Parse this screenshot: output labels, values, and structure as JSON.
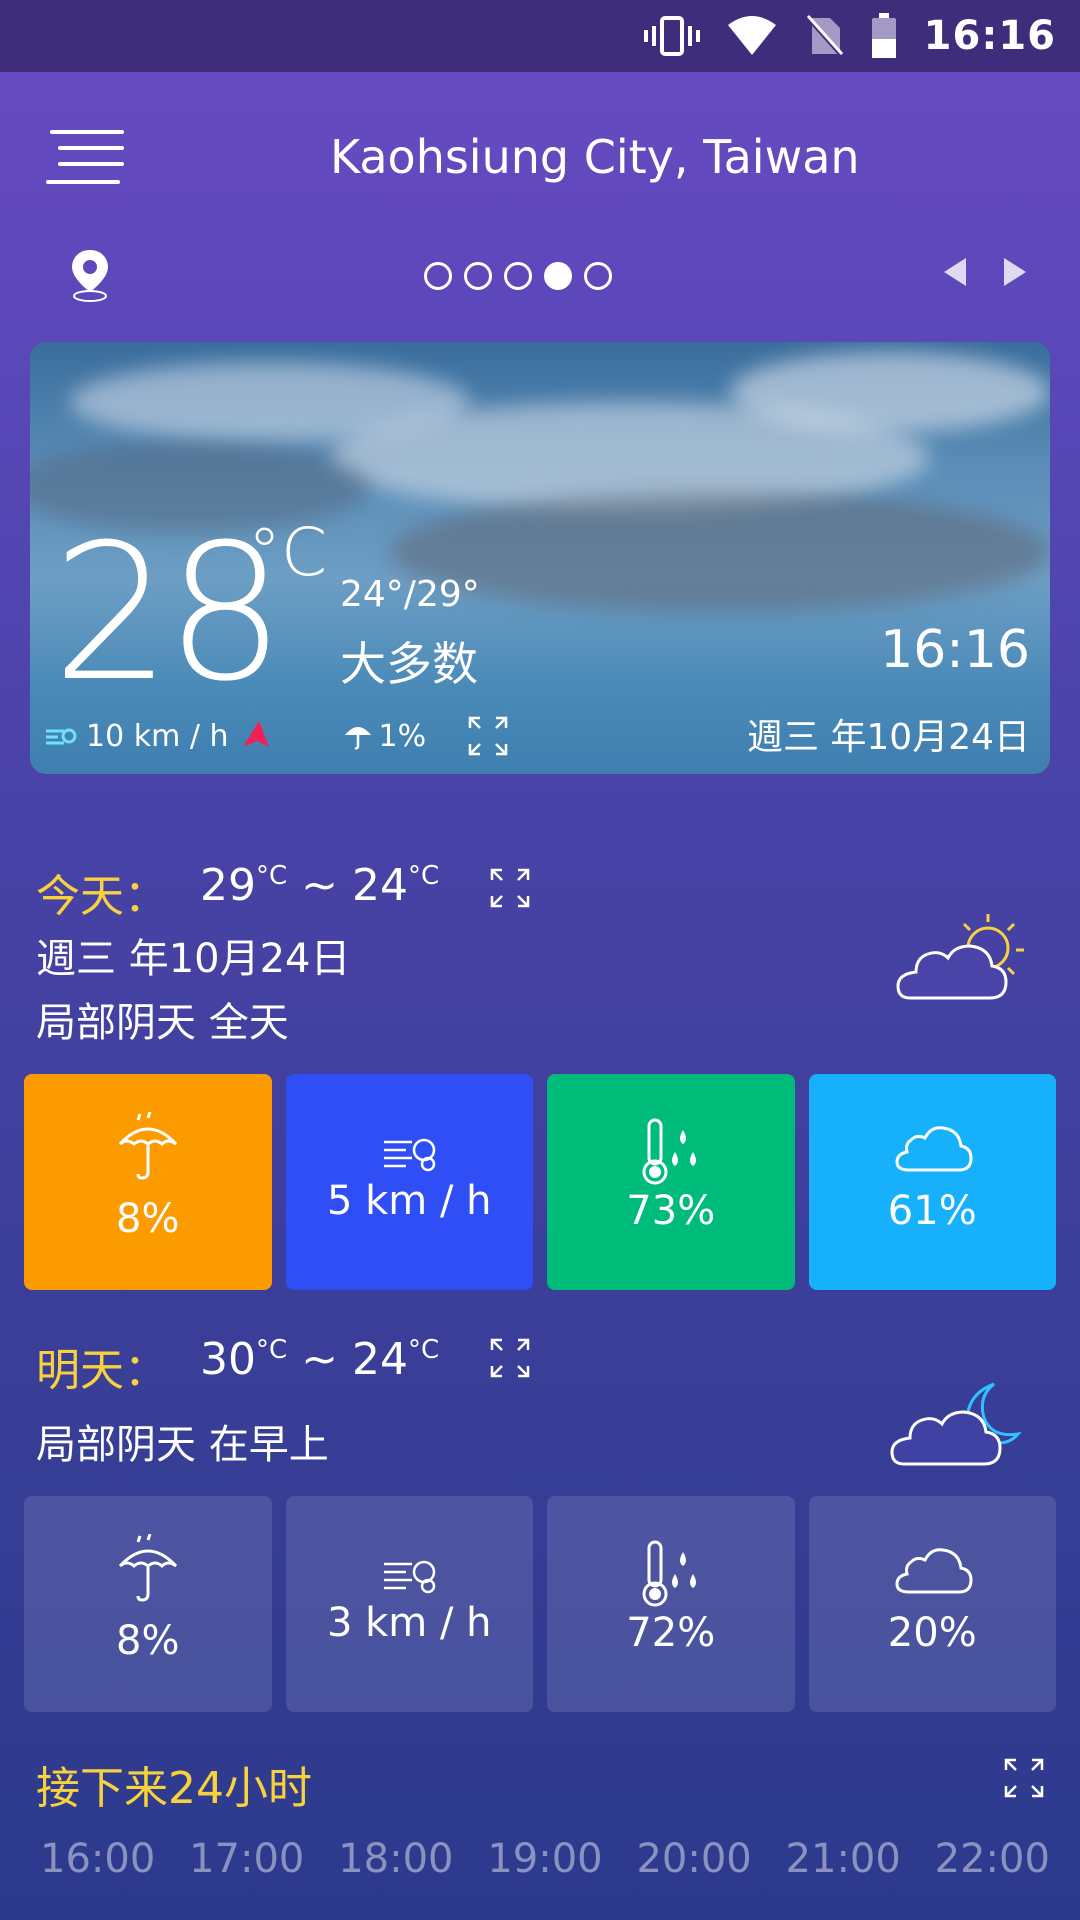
{
  "status_bar": {
    "time": "16:16"
  },
  "header": {
    "city": "Kaohsiung City, Taiwan"
  },
  "pager": {
    "total": 5,
    "active_index": 3
  },
  "current": {
    "temperature": "28",
    "unit": "°C",
    "range": "24°/29°",
    "condition": "大多数",
    "time": "16:16",
    "date": "週三 年10月24日",
    "wind": "10 km / h",
    "precip": "1%"
  },
  "today": {
    "label": "今天：",
    "high": "29",
    "tilde": "~",
    "low": "24",
    "unit": "C",
    "date": "週三 年10月24日",
    "desc": "局部阴天 全天",
    "tiles": [
      {
        "name": "precipitation",
        "value": "8%",
        "color": "#fb9b00"
      },
      {
        "name": "wind",
        "value": "5 km / h",
        "color": "#2f4ef5"
      },
      {
        "name": "humidity",
        "value": "73%",
        "color": "#00bc7a"
      },
      {
        "name": "cloud-cover",
        "value": "61%",
        "color": "#16b0fb"
      }
    ]
  },
  "tomorrow": {
    "label": "明天：",
    "high": "30",
    "tilde": "~",
    "low": "24",
    "unit": "C",
    "desc": "局部阴天 在早上",
    "tiles": [
      {
        "name": "precipitation",
        "value": "8%"
      },
      {
        "name": "wind",
        "value": "3 km / h"
      },
      {
        "name": "humidity",
        "value": "72%"
      },
      {
        "name": "cloud-cover",
        "value": "20%"
      }
    ]
  },
  "next24": {
    "title": "接下来24小时",
    "hours": [
      "16:00",
      "17:00",
      "18:00",
      "19:00",
      "20:00",
      "21:00",
      "22:00"
    ]
  }
}
